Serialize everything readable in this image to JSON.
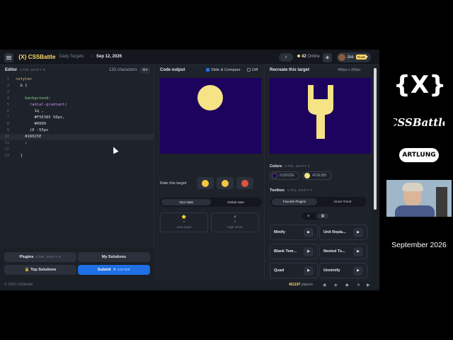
{
  "header": {
    "brand": "{X} CSSBattle",
    "crumb_daily": "Daily Targets",
    "crumb_sep": "›",
    "crumb_date": "Sep 12, 2026",
    "bell_icon": "bell-icon",
    "online_count": "42",
    "online_label": "Online",
    "user_name": "Joe",
    "user_badge": "PLUS"
  },
  "editor": {
    "title": "Editor",
    "shortcut": "CTRL SHIFT E",
    "chars": "133 characters",
    "lines": [
      {
        "n": "1",
        "t": "<style>"
      },
      {
        "n": "2",
        "t": "  & {"
      },
      {
        "n": "3",
        "t": ""
      },
      {
        "n": "4",
        "t": "    background:"
      },
      {
        "n": "5",
        "t": "      radial-gradient("
      },
      {
        "n": "6",
        "t": "        1q ,"
      },
      {
        "n": "7",
        "t": "        #F5E385 50px,"
      },
      {
        "n": "8",
        "t": "        #0000"
      },
      {
        "n": "9",
        "t": "      )0 -55px"
      },
      {
        "n": "10",
        "t": "    #1D025E"
      },
      {
        "n": "11",
        "t": "    ;"
      },
      {
        "n": "12",
        "t": ""
      },
      {
        "n": "13",
        "t": "  }"
      }
    ]
  },
  "left_buttons": {
    "plugins": "Plugins",
    "plugins_kbd": "CTRL SHIFT P",
    "my_solutions": "My Solutions",
    "top_solutions": "Top Solutions",
    "submit": "Submit",
    "submit_kbd": "⌘ ENTER"
  },
  "output": {
    "title": "Code output",
    "slide_compare": "Slide & Compare",
    "diff": "Diff",
    "rate_label": "Rate this target",
    "your_stats": "Your stats",
    "global_stats": "Global stats",
    "last_score_value": "-",
    "last_score_label": "Last score",
    "high_score_value": "-",
    "high_score_label": "High score"
  },
  "target": {
    "title": "Recreate this target",
    "size": "400px x 300px",
    "colors_label": "Colors",
    "colors_kbd": "CTRL SHIFT C",
    "colors": [
      {
        "hex": "#1D025E"
      },
      {
        "hex": "#F5E385"
      }
    ],
    "toolbox_label": "Toolbox",
    "toolbox_kbd": "CTRL SHIFT T",
    "tab_favorite": "Favorite Plugins",
    "tab_score": "Score Trend",
    "plugins": [
      "Minify",
      "Unit Repla...",
      "Blank Tem...",
      "Nested To...",
      "Quad",
      "Unminify"
    ]
  },
  "footer": {
    "copyright": "© 2026 CSSBattle",
    "players_count": "451197",
    "players_label": "players"
  },
  "side": {
    "logo_text": "{X}",
    "logo2_text": "CSSBattle",
    "logo3_text": "ARTLUNG",
    "date": "September 2026"
  },
  "colors": {
    "bg_canvas": "#1D025E",
    "accent_shape": "#F5E385",
    "brand": "#FFD866",
    "submit_blue": "#1F6FE5"
  }
}
